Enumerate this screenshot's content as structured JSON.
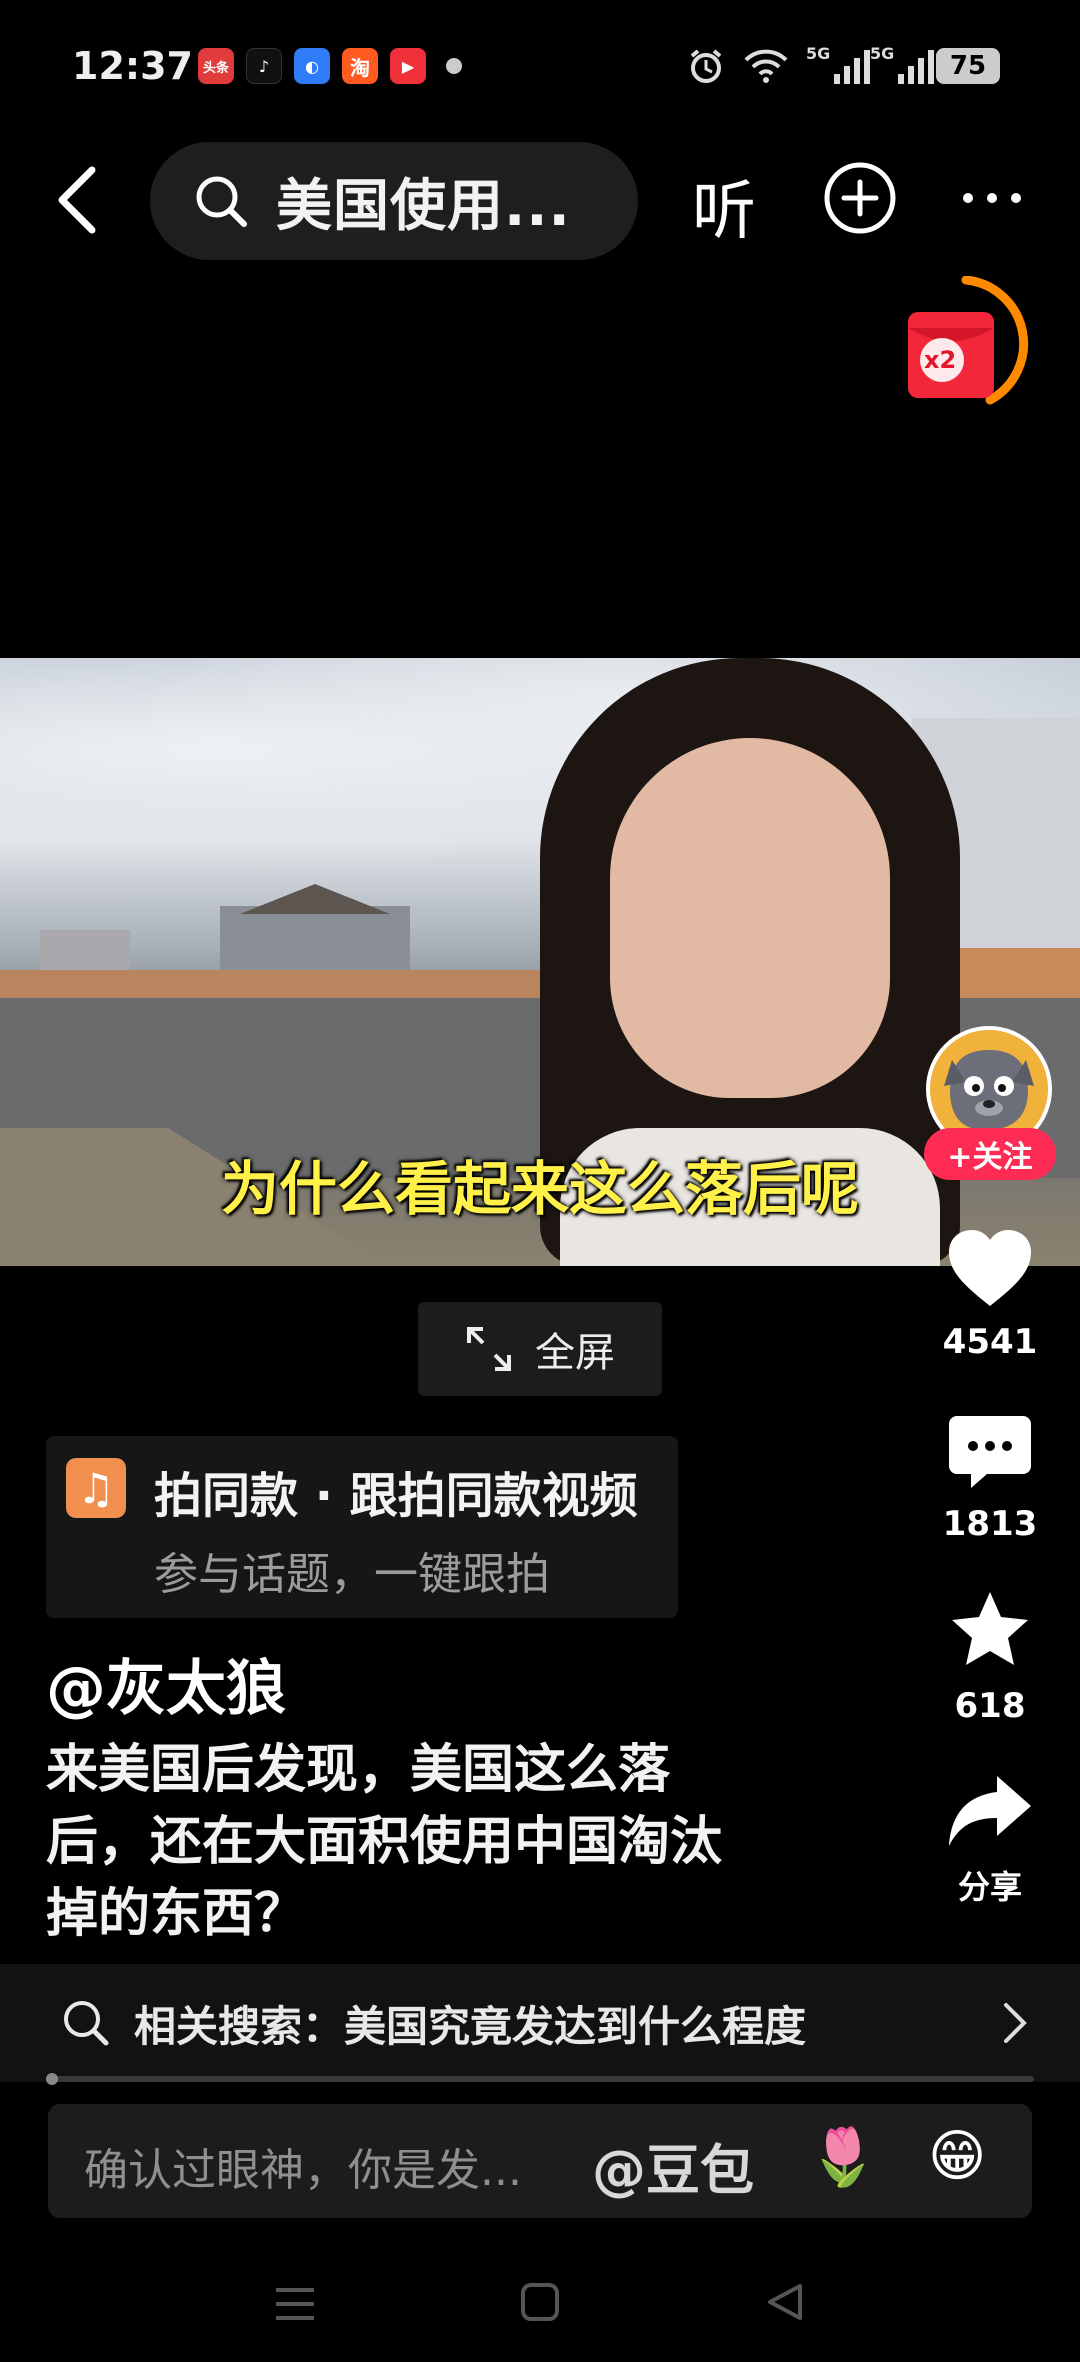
{
  "status_bar": {
    "time": "12:37",
    "battery": "75",
    "signal_labels": [
      "5G",
      "5G"
    ],
    "app_icons": [
      "头条",
      "douyin-icon",
      "browser-icon",
      "淘",
      "video-app-icon",
      "dot-icon"
    ]
  },
  "top_bar": {
    "search_text": "美国使用...",
    "listen_label": "听"
  },
  "red_packet": {
    "multiplier": "x2"
  },
  "video": {
    "subtitle": "为什么看起来这么落后呢",
    "fullscreen_label": "全屏"
  },
  "side_rail": {
    "follow_label": "+关注",
    "like_count": "4541",
    "comment_count": "1813",
    "favorite_count": "618",
    "share_label": "分享"
  },
  "music_card": {
    "title": "拍同款 · 跟拍同款视频",
    "subtitle": "参与话题，一键跟拍"
  },
  "post": {
    "author": "@灰太狼",
    "description_lines": [
      "来美国后发现，美国这么落",
      "后，还在大面积使用中国淘汰",
      "掉的东西？"
    ]
  },
  "related_search": {
    "text": "相关搜索：美国究竟发达到什么程度"
  },
  "comment_bar": {
    "placeholder": "确认过眼神，你是发...",
    "mention": "@豆包",
    "emoji_1": "🌷",
    "emoji_2": "😁"
  },
  "colors": {
    "accent_red": "#fe2c55",
    "subtitle_yellow": "#fff04a",
    "music_orange": "#f08f4e"
  },
  "video_progress": 0.01
}
